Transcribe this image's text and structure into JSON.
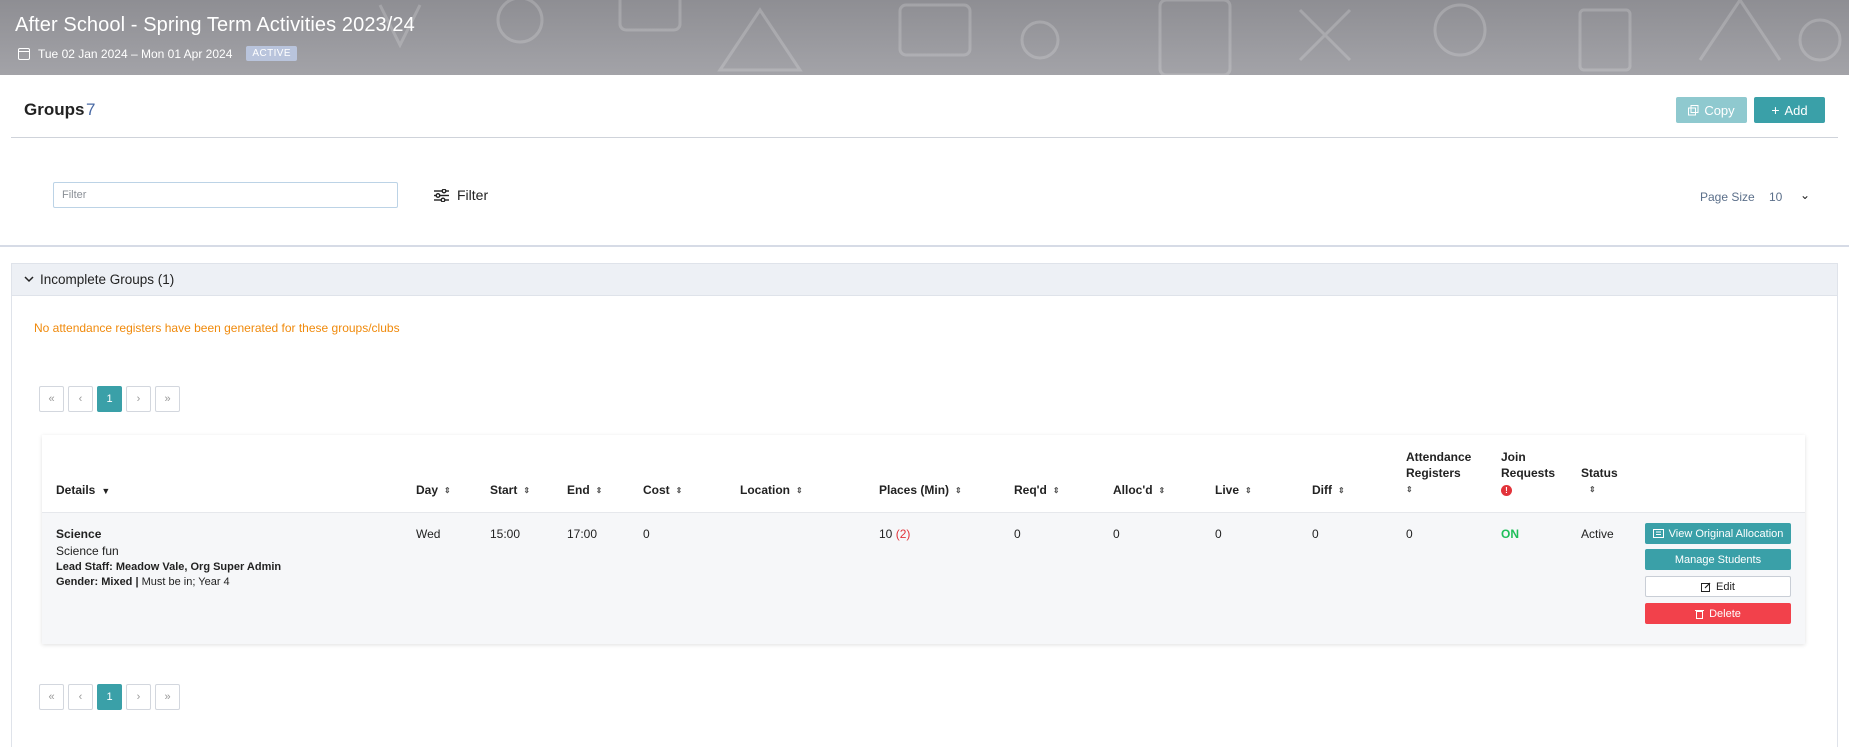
{
  "banner": {
    "title": "After School - Spring Term Activities 2023/24",
    "date_range": "Tue 02 Jan 2024 – Mon 01 Apr 2024",
    "status_badge": "ACTIVE"
  },
  "groups": {
    "title": "Groups",
    "count": "7",
    "copy_label": "Copy",
    "add_label": "Add"
  },
  "filter": {
    "placeholder": "Filter",
    "button_label": "Filter",
    "page_size_label": "Page Size",
    "page_size_value": "10"
  },
  "incomplete": {
    "title": "Incomplete Groups (1)",
    "warning": "No attendance registers have been generated for these groups/clubs"
  },
  "pagination": {
    "first": "«",
    "prev": "‹",
    "current": "1",
    "next": "›",
    "last": "»"
  },
  "table": {
    "headers": {
      "details": "Details",
      "day": "Day",
      "start": "Start",
      "end": "End",
      "cost": "Cost",
      "location": "Location",
      "places": "Places (Min)",
      "reqd": "Req'd",
      "allocd": "Alloc'd",
      "live": "Live",
      "diff": "Diff",
      "attendance_1": "Attendance",
      "attendance_2": "Registers",
      "join_1": "Join",
      "join_2": "Requests",
      "status": "Status"
    },
    "row": {
      "name": "Science",
      "description": "Science fun",
      "lead_staff": "Lead Staff: Meadow Vale, Org Super Admin",
      "gender_label": "Gender: Mixed |",
      "gender_rest": "Must be in; Year 4",
      "day": "Wed",
      "start": "15:00",
      "end": "17:00",
      "cost": "0",
      "location": "",
      "places": "10",
      "places_min": "(2)",
      "reqd": "0",
      "allocd": "0",
      "live": "0",
      "diff": "0",
      "attendance_registers": "0",
      "join_requests": "ON",
      "status": "Active",
      "actions": {
        "view_allocation": "View Original Allocation",
        "manage_students": "Manage Students",
        "edit": "Edit",
        "delete": "Delete"
      }
    }
  },
  "colors": {
    "accent": "#3aa0a8",
    "warning": "#f08a0c",
    "danger": "#f2414b",
    "success": "#1fbf5a"
  }
}
